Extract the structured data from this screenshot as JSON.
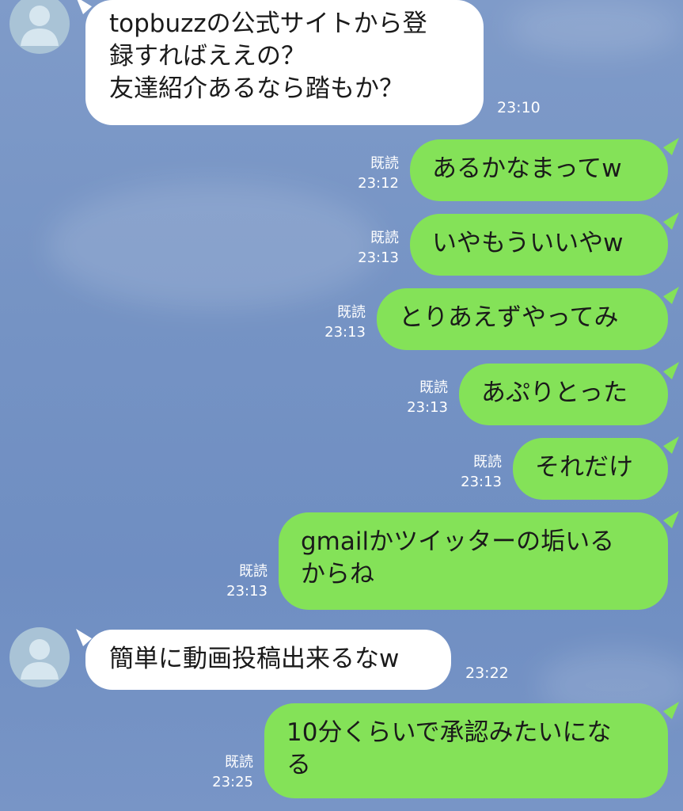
{
  "colors": {
    "background": "#7593c4",
    "incoming_bubble": "#ffffff",
    "outgoing_bubble": "#84e258",
    "meta_text": "#ffffff"
  },
  "messages": [
    {
      "direction": "in",
      "lines": [
        "topbuzzの公式サイトから登",
        "録すればええの？",
        "友達紹介あるなら踏もか？"
      ],
      "time": "23:10",
      "avatar_icon": "person-silhouette-icon"
    },
    {
      "direction": "out",
      "lines": [
        "あるかなまってw"
      ],
      "read": "既読",
      "time": "23:12"
    },
    {
      "direction": "out",
      "lines": [
        "いやもういいやw"
      ],
      "read": "既読",
      "time": "23:13"
    },
    {
      "direction": "out",
      "lines": [
        "とりあえずやってみ"
      ],
      "read": "既読",
      "time": "23:13"
    },
    {
      "direction": "out",
      "lines": [
        "あぷりとった"
      ],
      "read": "既読",
      "time": "23:13"
    },
    {
      "direction": "out",
      "lines": [
        "それだけ"
      ],
      "read": "既読",
      "time": "23:13"
    },
    {
      "direction": "out",
      "lines": [
        "gmailかツイッターの垢いる",
        "からね"
      ],
      "read": "既読",
      "time": "23:13"
    },
    {
      "direction": "in",
      "lines": [
        "簡単に動画投稿出来るなw"
      ],
      "time": "23:22",
      "avatar_icon": "person-silhouette-icon"
    },
    {
      "direction": "out",
      "lines": [
        "10分くらいで承認みたいにな",
        "る"
      ],
      "read": "既読",
      "time": "23:25"
    }
  ]
}
